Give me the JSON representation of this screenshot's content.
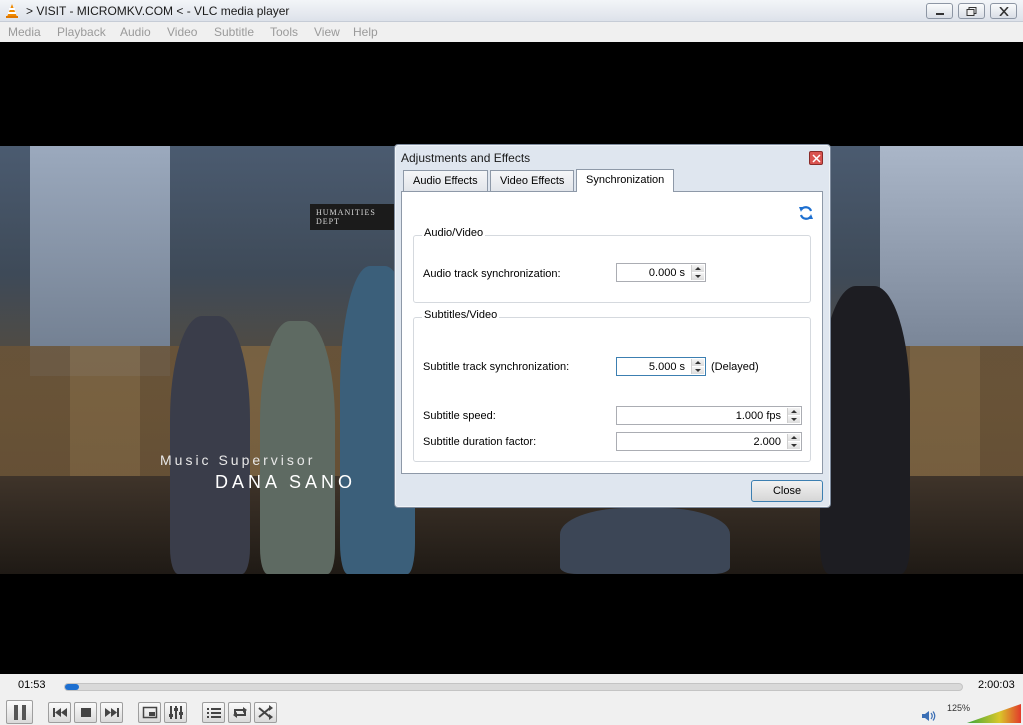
{
  "window": {
    "title": "> VISIT - MICROMKV.COM < - VLC media player"
  },
  "menubar": {
    "items": [
      "Media",
      "Playback",
      "Audio",
      "Video",
      "Subtitle",
      "Tools",
      "View",
      "Help"
    ]
  },
  "video": {
    "sign_text": "HUMANITIES DEPT",
    "credit_role": "Music Supervisor",
    "credit_name": "DANA SANO"
  },
  "dialog": {
    "title": "Adjustments and Effects",
    "tabs": [
      "Audio Effects",
      "Video Effects",
      "Synchronization"
    ],
    "active_tab": "Synchronization",
    "audio_video": {
      "group_title": "Audio/Video",
      "audio_sync_label": "Audio track synchronization:",
      "audio_sync_value": "0.000 s"
    },
    "subtitles_video": {
      "group_title": "Subtitles/Video",
      "subtitle_sync_label": "Subtitle track synchronization:",
      "subtitle_sync_value": "5.000 s",
      "subtitle_sync_status": "(Delayed)",
      "subtitle_speed_label": "Subtitle speed:",
      "subtitle_speed_value": "1.000 fps",
      "subtitle_duration_label": "Subtitle duration factor:",
      "subtitle_duration_value": "2.000"
    },
    "close_label": "Close"
  },
  "controls": {
    "elapsed": "01:53",
    "total": "2:00:03",
    "progress_fraction": 0.016,
    "volume_label": "125%",
    "volume_fraction": 1.0
  },
  "colors": {
    "accent": "#1d6fd0",
    "dialog_bg": "#dfe6ef",
    "volume_low": "#3aa63a",
    "volume_high": "#e23b2b"
  },
  "icons": [
    "vlc-cone-icon",
    "minimize-icon",
    "maximize-icon",
    "close-icon",
    "reset-icon",
    "pause-icon",
    "previous-icon",
    "stop-icon",
    "next-icon",
    "fullscreen-icon",
    "extended-settings-icon",
    "playlist-icon",
    "loop-icon",
    "shuffle-icon",
    "speaker-icon"
  ]
}
